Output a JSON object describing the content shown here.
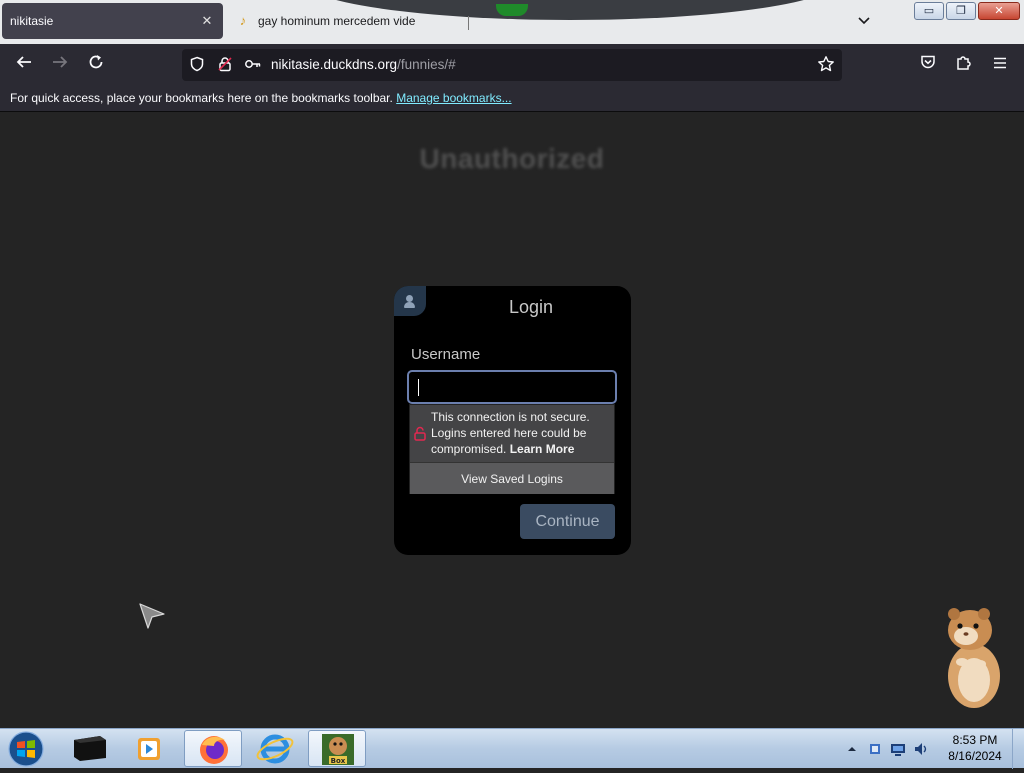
{
  "browser": {
    "tabs": [
      {
        "title": "nikitasie",
        "active": true
      },
      {
        "title": "gay hominum mercedem vide",
        "active": false
      }
    ],
    "window_controls": {
      "minimize": "▭",
      "restore": "❐",
      "close": "✕"
    },
    "url": {
      "host": "nikitasie.duckdns.org",
      "path": "/funnies/#"
    },
    "bookmarks_toolbar": {
      "message": "For quick access, place your bookmarks here on the bookmarks toolbar.",
      "manage_link": "Manage bookmarks..."
    }
  },
  "page": {
    "heading": "Unauthorized",
    "login": {
      "title": "Login",
      "username_label": "Username",
      "username_value": "",
      "continue_label": "Continue"
    },
    "insecure_popup": {
      "warning_text": "This connection is not secure. Logins entered here could be compromised.",
      "learn_more": "Learn More",
      "saved_logins_label": "View Saved Logins"
    }
  },
  "taskbar": {
    "items": [
      {
        "name": "start-button",
        "icon": "windows-logo-icon"
      },
      {
        "name": "taskbar-item-app",
        "icon": "black-box-icon"
      },
      {
        "name": "taskbar-item-media-player",
        "icon": "media-player-icon"
      },
      {
        "name": "taskbar-item-firefox",
        "icon": "firefox-icon",
        "active": true
      },
      {
        "name": "taskbar-item-internet-explorer",
        "icon": "internet-explorer-icon"
      },
      {
        "name": "taskbar-item-box",
        "icon": "box-icon",
        "active": true
      }
    ],
    "clock": {
      "time": "8:53 PM",
      "date": "8/16/2024"
    }
  },
  "colors": {
    "page_bg": "#242424",
    "toolbar_bg": "#2b2a33",
    "link": "#80ebff",
    "input_border": "#6b7fae",
    "continue_bg": "#3a4b61",
    "warning_icon": "#e22850"
  }
}
